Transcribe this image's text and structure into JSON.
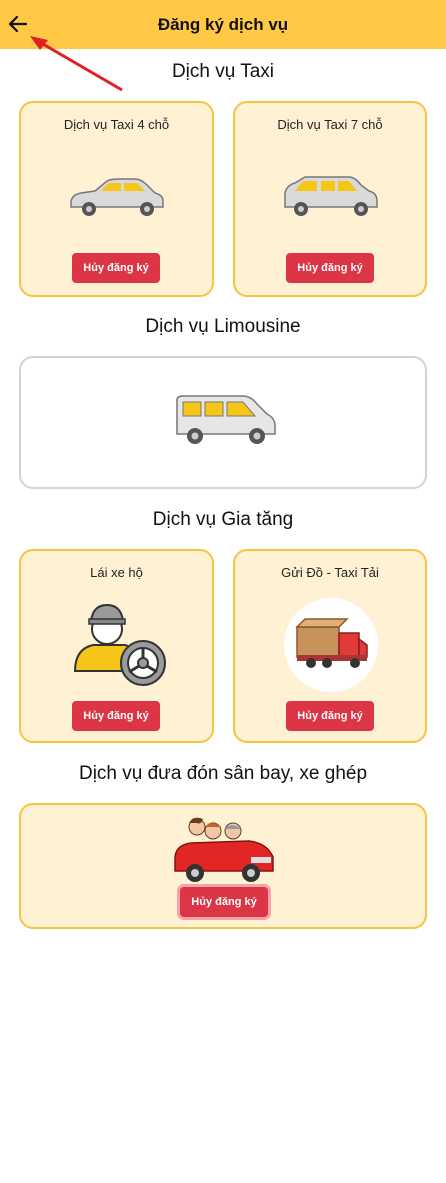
{
  "header": {
    "title": "Đăng ký dịch vụ"
  },
  "sections": {
    "taxi": {
      "title": "Dịch vụ Taxi",
      "cards": [
        {
          "label": "Dịch vụ Taxi 4 chỗ",
          "button": "Hủy đăng ký"
        },
        {
          "label": "Dịch vụ Taxi 7 chỗ",
          "button": "Hủy đăng ký"
        }
      ]
    },
    "limousine": {
      "title": "Dịch vụ Limousine"
    },
    "extra": {
      "title": "Dịch vụ Gia tăng",
      "cards": [
        {
          "label": "Lái xe hộ",
          "button": "Hủy đăng ký"
        },
        {
          "label": "Gửi Đồ - Taxi Tải",
          "button": "Hủy đăng ký"
        }
      ]
    },
    "airport": {
      "title": "Dịch vụ đưa đón sân bay, xe ghép",
      "button": "Hủy đăng ký"
    }
  },
  "colors": {
    "header": "#ffc845",
    "card_bg": "#fff2d4",
    "card_border": "#f5c542",
    "button": "#dc3545"
  }
}
